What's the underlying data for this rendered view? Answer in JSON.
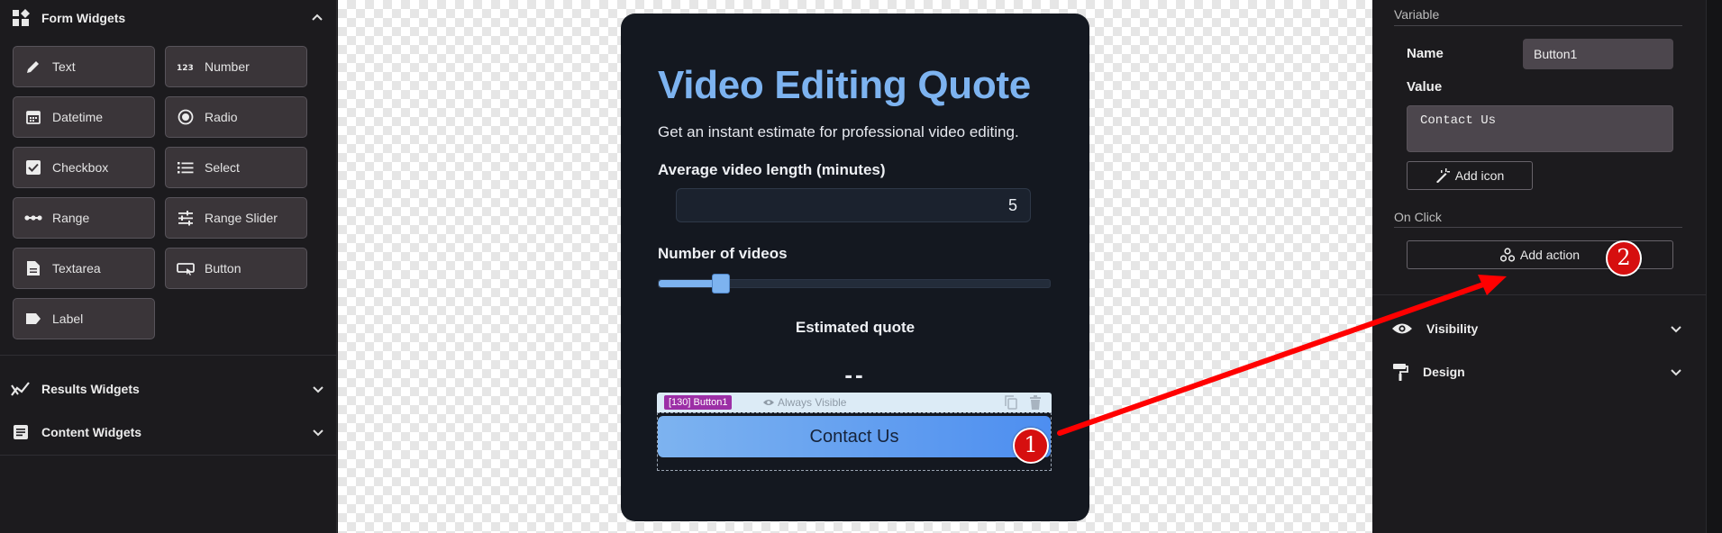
{
  "sidebar": {
    "form_widgets": {
      "title": "Form Widgets",
      "items": [
        {
          "label": "Text",
          "icon": "pencil-icon"
        },
        {
          "label": "Number",
          "icon": "number-icon"
        },
        {
          "label": "Datetime",
          "icon": "calendar-icon"
        },
        {
          "label": "Radio",
          "icon": "radio-icon"
        },
        {
          "label": "Checkbox",
          "icon": "checkbox-icon"
        },
        {
          "label": "Select",
          "icon": "list-icon"
        },
        {
          "label": "Range",
          "icon": "range-icon"
        },
        {
          "label": "Range Slider",
          "icon": "sliders-icon"
        },
        {
          "label": "Textarea",
          "icon": "document-icon"
        },
        {
          "label": "Button",
          "icon": "button-icon"
        },
        {
          "label": "Label",
          "icon": "label-icon"
        }
      ]
    },
    "results_widgets": {
      "title": "Results Widgets"
    },
    "content_widgets": {
      "title": "Content Widgets"
    }
  },
  "form": {
    "title": "Video Editing Quote",
    "subtitle": "Get an instant estimate for professional video editing.",
    "length_label": "Average video length (minutes)",
    "length_value": "5",
    "videos_label": "Number of videos",
    "videos_slider_fraction": 0.16,
    "videos_slider_value": "5",
    "quote_label": "Estimated quote",
    "quote_value": "--",
    "selection": {
      "tag": "[130] Button1",
      "visibility": "Always Visible"
    },
    "button_label": "Contact Us"
  },
  "panel": {
    "variable_section": "Variable",
    "name_label": "Name",
    "name_value": "Button1",
    "value_label": "Value",
    "value_text": "Contact Us",
    "add_icon_label": "Add icon",
    "onclick_section": "On Click",
    "add_action_label": "Add action",
    "visibility_label": "Visibility",
    "design_label": "Design"
  },
  "annotations": {
    "badge_1": "1",
    "badge_2": "2",
    "arrow_color": "#ff0000"
  }
}
